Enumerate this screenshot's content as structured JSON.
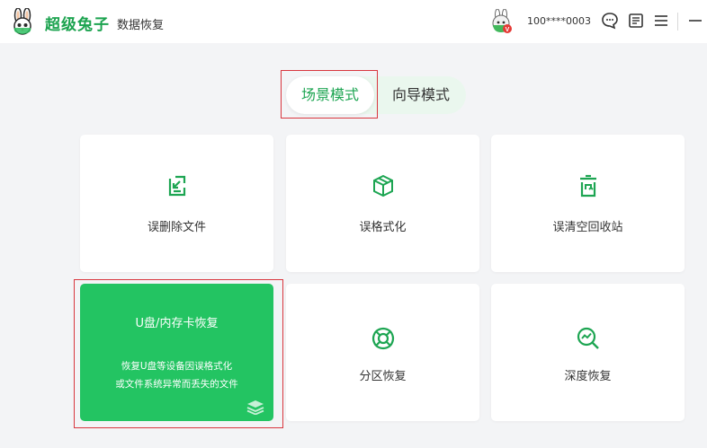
{
  "app": {
    "brand": "超级兔子",
    "subtitle": "数据恢复",
    "user": "100****0003",
    "avatar_badge": "V"
  },
  "toolbar": {
    "icons": [
      "chat-bubble-icon",
      "document-icon",
      "menu-icon",
      "minimize-icon"
    ]
  },
  "modes": {
    "active": "场景模式",
    "inactive": "向导模式"
  },
  "cards": [
    {
      "label": "误删除文件",
      "icon": "download-file-icon"
    },
    {
      "label": "误格式化",
      "icon": "box-icon"
    },
    {
      "label": "误清空回收站",
      "icon": "recycle-bin-icon"
    },
    {
      "label": "分区恢复",
      "icon": "lifebuoy-icon"
    },
    {
      "label": "深度恢复",
      "icon": "magnifier-chart-icon"
    }
  ],
  "featured_card": {
    "title": "U盘/内存卡恢复",
    "desc_line1": "恢复U盘等设备因误格式化",
    "desc_line2": "或文件系统异常而丢失的文件",
    "icon": "stack-icon"
  },
  "colors": {
    "accent": "#1da552",
    "featured_bg": "#23c462",
    "highlight_border": "#d9363e"
  }
}
